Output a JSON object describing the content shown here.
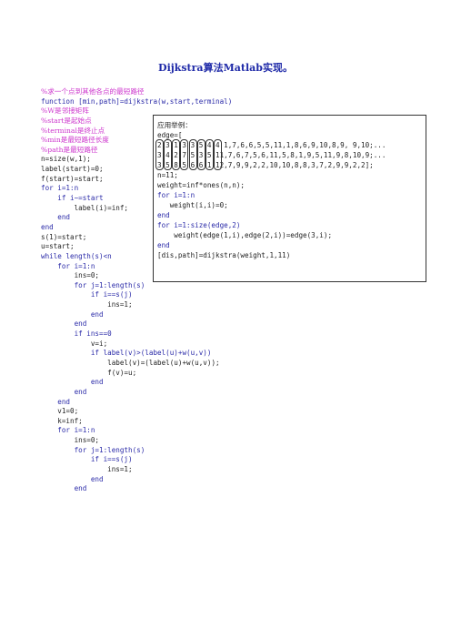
{
  "title": "Dijkstra算法Matlab实现。",
  "code_lines": [
    {
      "text": "%求一个点到其他各点的最短路径",
      "kind": "comment"
    },
    {
      "text": "function [min,path]=dijkstra(w,start,terminal)",
      "kind": "code"
    },
    {
      "text": "%W是邻接矩阵",
      "kind": "comment"
    },
    {
      "text": "%start是起始点",
      "kind": "comment"
    },
    {
      "text": "%terminal是终止点",
      "kind": "comment"
    },
    {
      "text": "%min是最短路径长度",
      "kind": "comment"
    },
    {
      "text": "%path是最短路径",
      "kind": "comment"
    },
    {
      "text": "n=size(w,1);",
      "kind": "black"
    },
    {
      "text": "label(start)=0;",
      "kind": "black"
    },
    {
      "text": "f(start)=start;",
      "kind": "black"
    },
    {
      "text": "for i=1:n",
      "kind": "code"
    },
    {
      "text": "    if i~=start",
      "kind": "code"
    },
    {
      "text": "        label(i)=inf;",
      "kind": "black"
    },
    {
      "text": "    end",
      "kind": "code"
    },
    {
      "text": "end",
      "kind": "code"
    },
    {
      "text": "s(1)=start;",
      "kind": "black"
    },
    {
      "text": "u=start;",
      "kind": "black"
    },
    {
      "text": "while length(s)<n",
      "kind": "code"
    },
    {
      "text": "    for i=1:n",
      "kind": "code"
    },
    {
      "text": "        ins=0;",
      "kind": "black"
    },
    {
      "text": "        for j=1:length(s)",
      "kind": "code"
    },
    {
      "text": "            if i==s(j)",
      "kind": "code"
    },
    {
      "text": "                ins=1;",
      "kind": "black"
    },
    {
      "text": "            end",
      "kind": "code"
    },
    {
      "text": "        end",
      "kind": "code"
    },
    {
      "text": "        if ins==0",
      "kind": "code"
    },
    {
      "text": "            v=i;",
      "kind": "black"
    },
    {
      "text": "            if label(v)>(label(u)+w(u,v))",
      "kind": "code"
    },
    {
      "text": "                label(v)=(label(u)+w(u,v));",
      "kind": "black"
    },
    {
      "text": "                f(v)=u;",
      "kind": "black"
    },
    {
      "text": "            end",
      "kind": "code"
    },
    {
      "text": "        end",
      "kind": "code"
    },
    {
      "text": "    end",
      "kind": "code"
    },
    {
      "text": "    v1=0;",
      "kind": "black"
    },
    {
      "text": "    k=inf;",
      "kind": "black"
    },
    {
      "text": "    for i=1:n",
      "kind": "code"
    },
    {
      "text": "        ins=0;",
      "kind": "black"
    },
    {
      "text": "        for j=1:length(s)",
      "kind": "code"
    },
    {
      "text": "            if i==s(j)",
      "kind": "code"
    },
    {
      "text": "                ins=1;",
      "kind": "black"
    },
    {
      "text": "            end",
      "kind": "code"
    },
    {
      "text": "        end",
      "kind": "code"
    }
  ],
  "example_box": {
    "lines": [
      {
        "text": "应用举例：",
        "kind": "label"
      },
      {
        "text": "edge=[",
        "kind": "black"
      },
      {
        "text": "2 3 1 3 3 5 4 4 1,7,6,6,5,5,11,1,8,6,9,10,8,9, 9,10;...",
        "kind": "black"
      },
      {
        "text": "3 4 2 7 5 3 5 11,7,6,7,5,6,11,5,8,1,9,5,11,9,8,10,9;...",
        "kind": "black"
      },
      {
        "text": "3 5 8 5 6 6 1 12,7,9,9,2,2,10,10,8,8,3,7,2,9,9,2,2];",
        "kind": "black"
      },
      {
        "text": "n=11;",
        "kind": "black"
      },
      {
        "text": "weight=inf*ones(n,n);",
        "kind": "black"
      },
      {
        "text": "for i=1:n",
        "kind": "code"
      },
      {
        "text": "   weight(i,i)=0;",
        "kind": "black"
      },
      {
        "text": "end",
        "kind": "code"
      },
      {
        "text": "for i=1:size(edge,2)",
        "kind": "code"
      },
      {
        "text": "    weight(edge(1,i),edge(2,i))=edge(3,i);",
        "kind": "black"
      },
      {
        "text": "end",
        "kind": "code"
      },
      {
        "text": "[dis,path]=dijkstra(weight,1,11)",
        "kind": "black"
      }
    ]
  }
}
